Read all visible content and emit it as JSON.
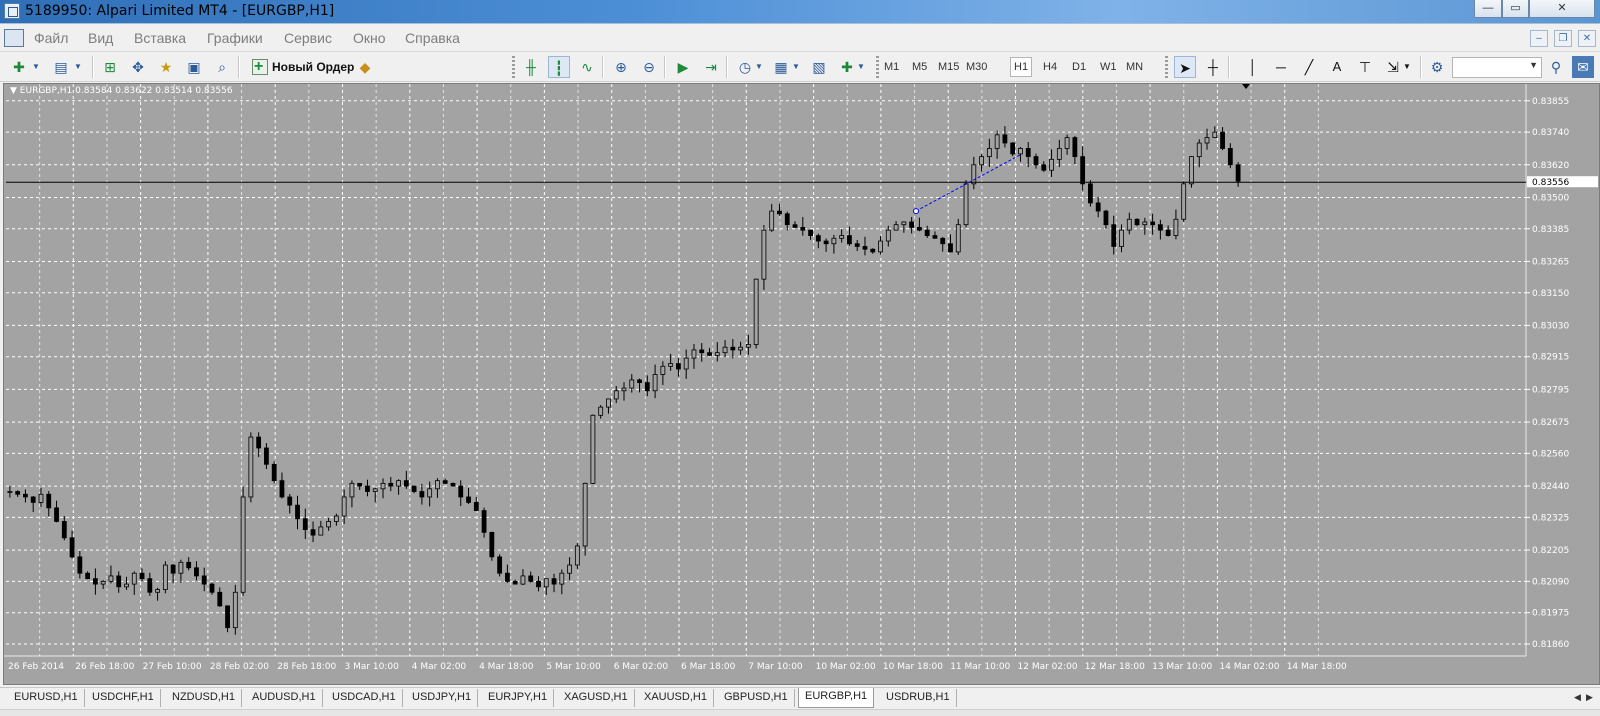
{
  "window": {
    "title": "5189950: Alpari Limited MT4 - [EURGBP,H1]",
    "controls": {
      "minimize": "—",
      "maximize": "▭",
      "close": "✕"
    }
  },
  "menu": {
    "items": [
      "Файл",
      "Вид",
      "Вставка",
      "Графики",
      "Сервис",
      "Окно",
      "Справка"
    ],
    "mdi": {
      "minimize": "–",
      "restore": "❐",
      "close": "✕"
    }
  },
  "toolbar": {
    "new_order_label": "Новый Ордер",
    "timeframes": [
      "M1",
      "M5",
      "M15",
      "M30",
      "H1",
      "H4",
      "D1",
      "W1",
      "MN"
    ],
    "active_timeframe": "H1",
    "icons": [
      "new-chart-icon",
      "profiles-icon",
      "market-watch-icon",
      "navigator-icon",
      "data-window-icon",
      "terminal-icon",
      "strategy-tester-icon",
      "new-order-icon",
      "expert-advisors-icon",
      "bar-chart-icon",
      "candlestick-icon",
      "line-chart-icon",
      "zoom-in-icon",
      "zoom-out-icon",
      "auto-scroll-icon",
      "chart-shift-icon",
      "periods-icon",
      "indicators-icon",
      "templates-icon",
      "cursor-icon",
      "crosshair-icon",
      "vertical-line-icon",
      "horizontal-line-icon",
      "trendline-icon",
      "text-icon",
      "text-label-icon",
      "arrows-icon",
      "settings-icon",
      "search-icon",
      "chat-icon"
    ]
  },
  "chart_data": {
    "type": "candlestick",
    "symbol": "EURGBP,H1",
    "header_text": "EURGBP,H1  0.83584 0.83622 0.83514 0.83556",
    "ohlc": {
      "open": 0.83584,
      "high": 0.83622,
      "low": 0.83514,
      "close": 0.83556
    },
    "current_price": 0.83556,
    "current_price_label": "0.83556",
    "ylim": [
      0.8186,
      0.8388
    ],
    "y_ticks": [
      "0.83855",
      "0.83740",
      "0.83620",
      "0.83500",
      "0.83385",
      "0.83265",
      "0.83150",
      "0.83030",
      "0.82915",
      "0.82795",
      "0.82675",
      "0.82560",
      "0.82440",
      "0.82325",
      "0.82205",
      "0.82090",
      "0.81975",
      "0.81860"
    ],
    "y_tick_values": [
      0.83855,
      0.8374,
      0.8362,
      0.835,
      0.83385,
      0.83265,
      0.8315,
      0.8303,
      0.82915,
      0.82795,
      0.82675,
      0.8256,
      0.8244,
      0.82325,
      0.82205,
      0.8209,
      0.81975,
      0.8186
    ],
    "x_ticks": [
      "26 Feb 2014",
      "26 Feb 18:00",
      "27 Feb 10:00",
      "28 Feb 02:00",
      "28 Feb 18:00",
      "3 Mar 10:00",
      "4 Mar 02:00",
      "4 Mar 18:00",
      "5 Mar 10:00",
      "6 Mar 02:00",
      "6 Mar 18:00",
      "7 Mar 10:00",
      "10 Mar 02:00",
      "10 Mar 18:00",
      "11 Mar 10:00",
      "12 Mar 02:00",
      "12 Mar 18:00",
      "13 Mar 10:00",
      "14 Mar 02:00",
      "14 Mar 18:00"
    ],
    "closes": [
      0.8242,
      0.8241,
      0.824,
      0.8238,
      0.8241,
      0.8236,
      0.8231,
      0.8225,
      0.8218,
      0.8212,
      0.821,
      0.8208,
      0.8209,
      0.8211,
      0.8207,
      0.8208,
      0.8212,
      0.821,
      0.8205,
      0.8206,
      0.8215,
      0.8212,
      0.8216,
      0.8214,
      0.8211,
      0.8208,
      0.8205,
      0.82,
      0.8192,
      0.8205,
      0.824,
      0.8262,
      0.8258,
      0.8252,
      0.8246,
      0.824,
      0.8237,
      0.8232,
      0.8228,
      0.8226,
      0.8229,
      0.8231,
      0.8233,
      0.824,
      0.8245,
      0.8244,
      0.8242,
      0.8243,
      0.8245,
      0.8244,
      0.8246,
      0.8244,
      0.8242,
      0.824,
      0.8243,
      0.8246,
      0.8245,
      0.8244,
      0.824,
      0.8238,
      0.8235,
      0.8227,
      0.8218,
      0.8212,
      0.8209,
      0.8208,
      0.8211,
      0.8209,
      0.8207,
      0.821,
      0.8208,
      0.8212,
      0.8215,
      0.8222,
      0.8245,
      0.827,
      0.8273,
      0.8276,
      0.8279,
      0.828,
      0.8283,
      0.8282,
      0.8279,
      0.8285,
      0.8288,
      0.8289,
      0.8287,
      0.8291,
      0.8294,
      0.8293,
      0.8292,
      0.8293,
      0.8295,
      0.8294,
      0.8295,
      0.8296,
      0.832,
      0.8338,
      0.8345,
      0.8344,
      0.834,
      0.8339,
      0.8338,
      0.8336,
      0.8334,
      0.8333,
      0.8335,
      0.8336,
      0.8333,
      0.8332,
      0.8331,
      0.833,
      0.8334,
      0.8338,
      0.834,
      0.8341,
      0.8339,
      0.8338,
      0.8336,
      0.8335,
      0.8333,
      0.833,
      0.834,
      0.8355,
      0.8362,
      0.8365,
      0.8368,
      0.8373,
      0.837,
      0.8366,
      0.8368,
      0.8365,
      0.8362,
      0.836,
      0.8364,
      0.8368,
      0.8372,
      0.8365,
      0.8355,
      0.8348,
      0.8345,
      0.834,
      0.8332,
      0.8338,
      0.8342,
      0.834,
      0.8341,
      0.834,
      0.8338,
      0.8336,
      0.8342,
      0.8355,
      0.8365,
      0.837,
      0.8372,
      0.8374,
      0.8368,
      0.8362,
      0.8356
    ]
  },
  "tabs": [
    "EURUSD,H1",
    "USDCHF,H1",
    "NZDUSD,H1",
    "AUDUSD,H1",
    "USDCAD,H1",
    "USDJPY,H1",
    "EURJPY,H1",
    "XAGUSD,H1",
    "XAUUSD,H1",
    "GBPUSD,H1",
    "EURGBP,H1",
    "USDRUB,H1"
  ],
  "active_tab": "EURGBP,H1",
  "colors": {
    "chart_bg": "#a3a3a3",
    "candles": "#000000",
    "grid": "#ffffff",
    "trendline": "#0000ff",
    "price_line": "#000000"
  }
}
